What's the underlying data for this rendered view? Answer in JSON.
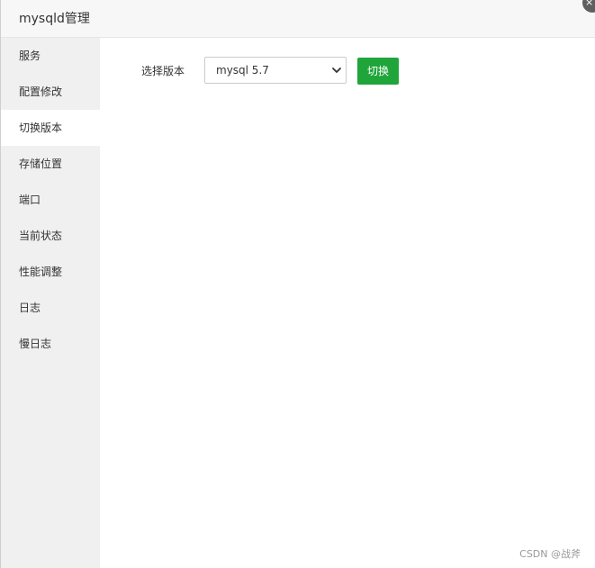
{
  "window": {
    "title": "mysqld管理",
    "close_glyph": "×"
  },
  "sidebar": {
    "items": [
      {
        "label": "服务"
      },
      {
        "label": "配置修改"
      },
      {
        "label": "切换版本"
      },
      {
        "label": "存储位置"
      },
      {
        "label": "端口"
      },
      {
        "label": "当前状态"
      },
      {
        "label": "性能调整"
      },
      {
        "label": "日志"
      },
      {
        "label": "慢日志"
      }
    ],
    "active_index": 2
  },
  "main": {
    "version_label": "选择版本",
    "version_select_value": "mysql 5.7",
    "switch_button_label": "切换"
  },
  "watermark": "CSDN @战斧",
  "colors": {
    "accent_green": "#20a53a",
    "sidebar_bg": "#f0f0f0",
    "titlebar_bg": "#f7f7f7"
  }
}
